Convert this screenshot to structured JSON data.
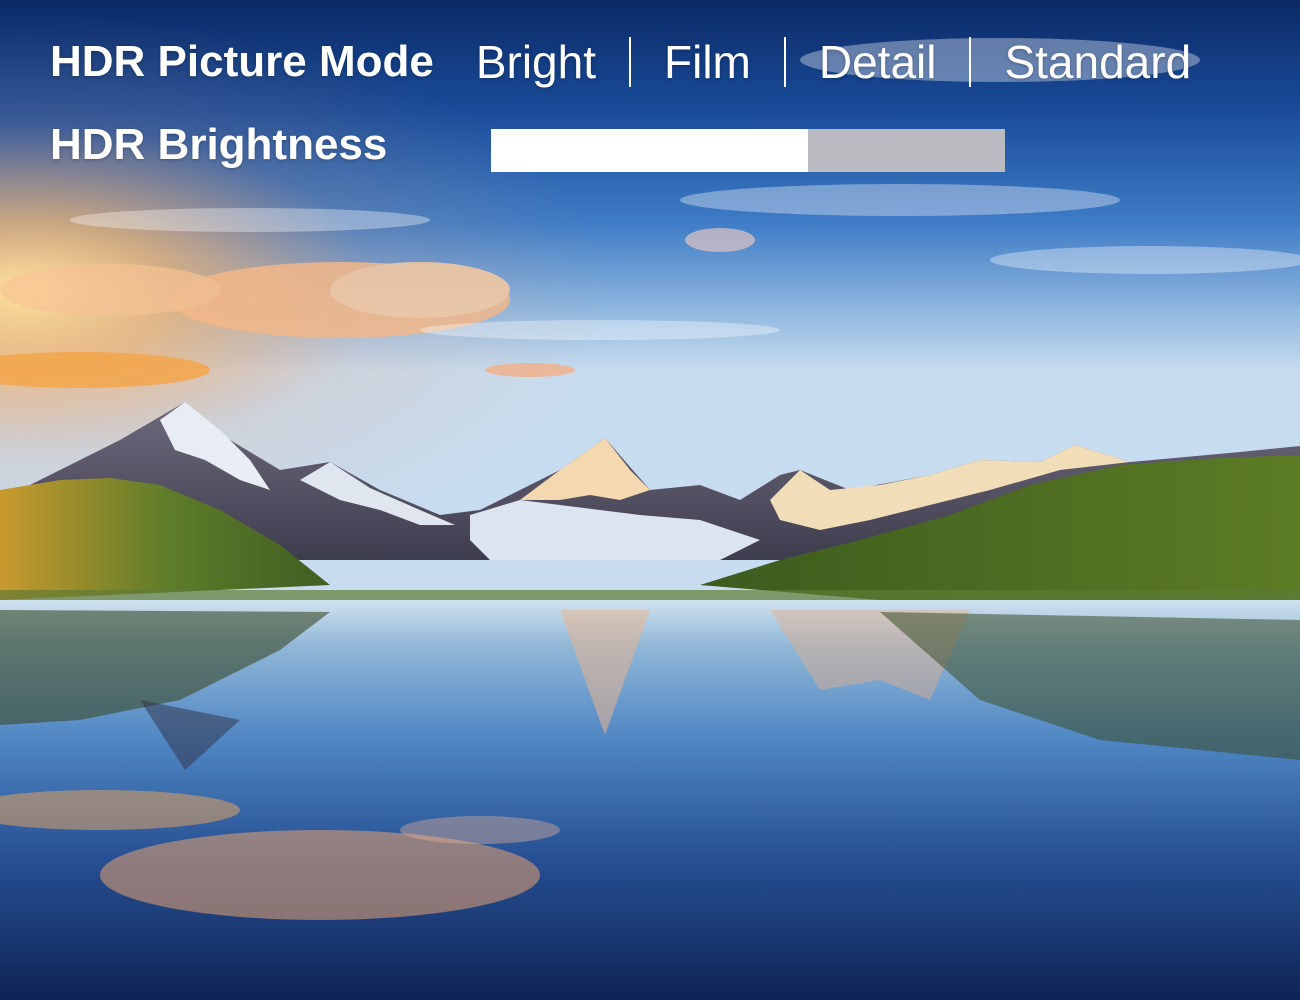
{
  "osd": {
    "picture_mode": {
      "label": "HDR Picture Mode",
      "options": [
        "Bright",
        "Film",
        "Detail",
        "Standard"
      ]
    },
    "brightness": {
      "label": "HDR Brightness",
      "level": 0.617
    }
  },
  "colors": {
    "text": "#ffffff",
    "slider_fill": "#ffffff",
    "slider_track": "#b9bbc0"
  }
}
